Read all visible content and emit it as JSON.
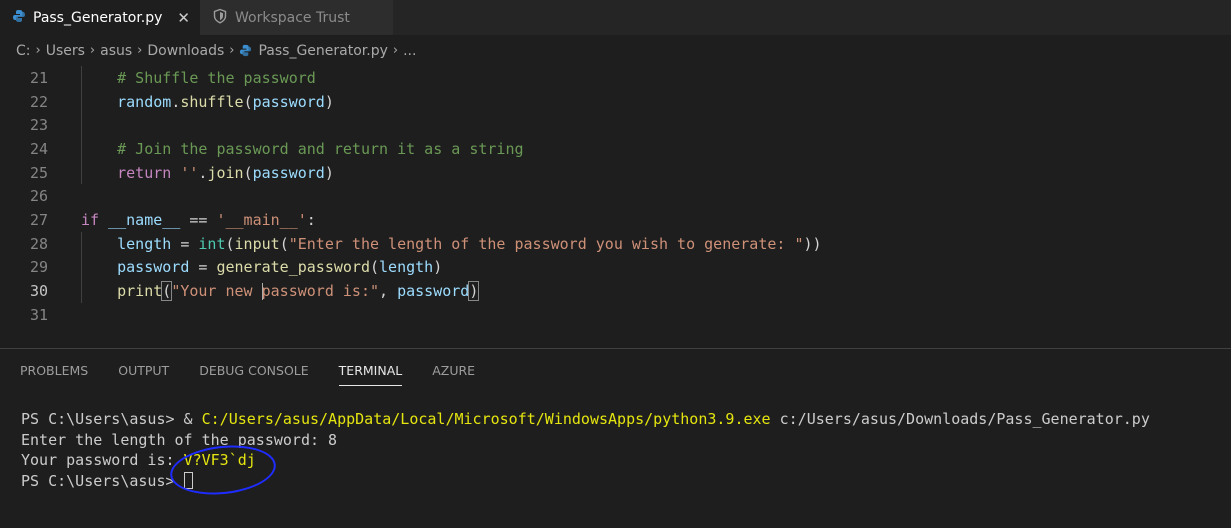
{
  "tabs": [
    {
      "label": "Pass_Generator.py",
      "icon": "python-icon",
      "active": true
    },
    {
      "label": "Workspace Trust",
      "icon": "shield-icon",
      "active": false
    }
  ],
  "breadcrumb": [
    "C:",
    "Users",
    "asus",
    "Downloads",
    "Pass_Generator.py",
    "..."
  ],
  "editor": {
    "lines": [
      {
        "num": "21",
        "code": "    # Shuffle the password"
      },
      {
        "num": "22",
        "code": "    random.shuffle(password)"
      },
      {
        "num": "23",
        "code": ""
      },
      {
        "num": "24",
        "code": "    # Join the password and return it as a string"
      },
      {
        "num": "25",
        "code": "    return ''.join(password)"
      },
      {
        "num": "26",
        "code": ""
      },
      {
        "num": "27",
        "code": "if __name__ == '__main__':"
      },
      {
        "num": "28",
        "code": "    length = int(input(\"Enter the length of the password you wish to generate: \"))"
      },
      {
        "num": "29",
        "code": "    password = generate_password(length)"
      },
      {
        "num": "30",
        "code": "    print(\"Your new password is:\", password)"
      },
      {
        "num": "31",
        "code": ""
      }
    ]
  },
  "panel": {
    "tabs": [
      "PROBLEMS",
      "OUTPUT",
      "DEBUG CONSOLE",
      "TERMINAL",
      "AZURE"
    ],
    "active_tab": "TERMINAL"
  },
  "terminal": {
    "line1_prompt": "PS C:\\Users\\asus> & ",
    "line1_exe": "C:/Users/asus/AppData/Local/Microsoft/WindowsApps/python3.9.exe",
    "line1_arg": " c:/Users/asus/Downloads/Pass_Generator.py",
    "line2": "Enter the length of the password: 8",
    "line3_label": "Your password is: ",
    "line3_value": "V?VF3`dj",
    "line4_prompt": "PS C:\\Users\\asus> "
  },
  "colors": {
    "annotation": "#1f2cff",
    "accent": "#e5e510"
  }
}
